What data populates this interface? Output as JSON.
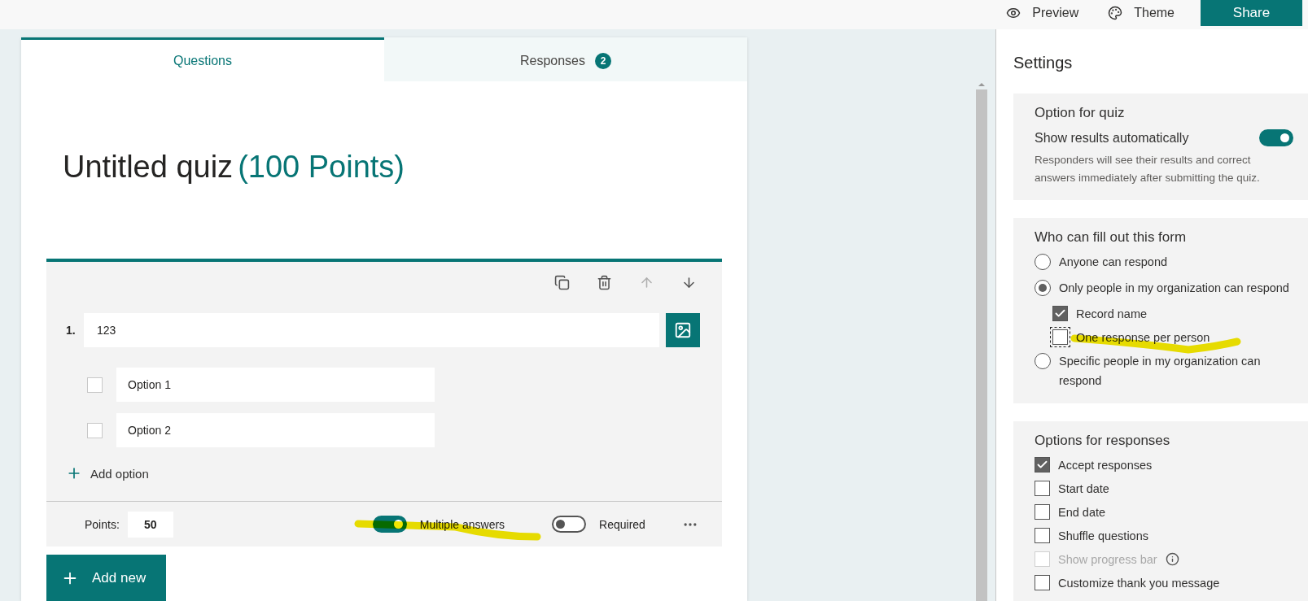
{
  "toolbar": {
    "preview": "Preview",
    "theme": "Theme",
    "share": "Share"
  },
  "tabs": [
    {
      "label": "Questions",
      "selected": true
    },
    {
      "label": "Responses",
      "selected": false,
      "badge": "2"
    }
  ],
  "quiz": {
    "title": "Untitled quiz",
    "points": "(100 Points)"
  },
  "question": {
    "number": "1.",
    "text": "123",
    "options": [
      {
        "label": "Option 1",
        "checked": false
      },
      {
        "label": "Option 2",
        "checked": false
      }
    ],
    "add_option": "Add option",
    "points_label": "Points:",
    "points": "50",
    "toggles": [
      {
        "label": "Multiple answers",
        "on": true
      },
      {
        "label": "Required",
        "on": false
      }
    ]
  },
  "add_new": "Add new",
  "settings": {
    "title": "Settings",
    "sections": [
      {
        "heading": "Option for quiz",
        "items": [
          {
            "kind": "toggle",
            "label": "Show results automatically",
            "on": true
          },
          {
            "kind": "note",
            "label": "Responders will see their results and correct answers immediately after submitting the quiz."
          }
        ]
      },
      {
        "heading": "Who can fill out this form",
        "items": [
          {
            "kind": "radio",
            "label": "Anyone can respond",
            "selected": false
          },
          {
            "kind": "radio",
            "label": "Only people in my organization can respond",
            "selected": true,
            "children": [
              {
                "kind": "checkbox",
                "label": "Record name",
                "checked": true,
                "focused": false
              },
              {
                "kind": "checkbox",
                "label": "One response per person",
                "checked": false,
                "focused": true
              }
            ]
          },
          {
            "kind": "radio",
            "label": "Specific people in my organization can respond",
            "selected": false
          }
        ]
      },
      {
        "heading": "Options for responses",
        "items": [
          {
            "kind": "checkbox",
            "label": "Accept responses",
            "checked": true,
            "disabled": false,
            "info": false
          },
          {
            "kind": "checkbox",
            "label": "Start date",
            "checked": false,
            "disabled": false,
            "info": false
          },
          {
            "kind": "checkbox",
            "label": "End date",
            "checked": false,
            "disabled": false,
            "info": false
          },
          {
            "kind": "checkbox",
            "label": "Shuffle questions",
            "checked": false,
            "disabled": false,
            "info": false
          },
          {
            "kind": "checkbox",
            "label": "Show progress bar",
            "checked": false,
            "disabled": true,
            "info": true
          },
          {
            "kind": "checkbox",
            "label": "Customize thank you message",
            "checked": false,
            "disabled": false,
            "info": false
          }
        ]
      }
    ]
  }
}
